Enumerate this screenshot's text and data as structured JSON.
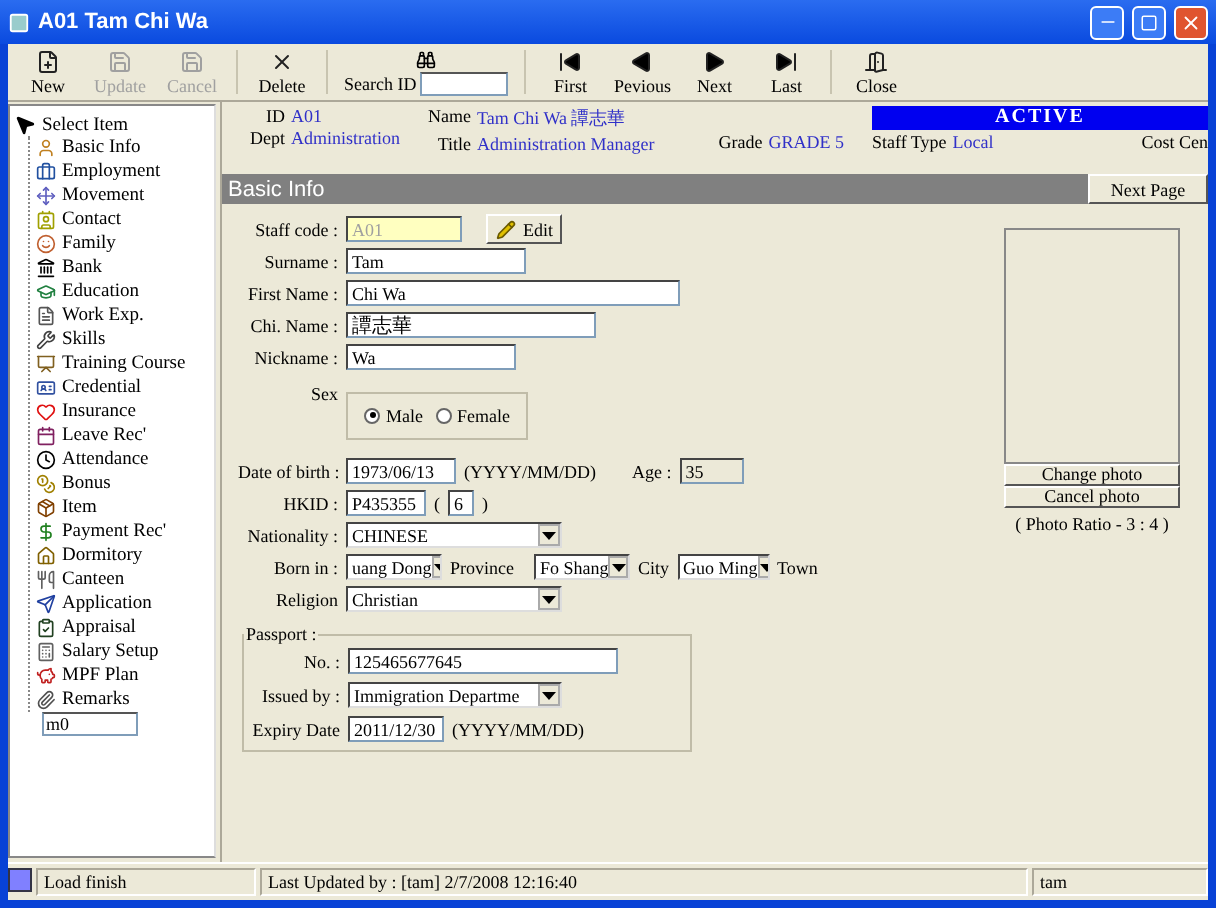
{
  "window": {
    "title": "A01 Tam Chi Wa"
  },
  "toolbar": [
    {
      "kind": "button",
      "label": "New",
      "disabled": false
    },
    {
      "kind": "button",
      "label": "Update",
      "disabled": true
    },
    {
      "kind": "button",
      "label": "Cancel",
      "disabled": true
    },
    {
      "kind": "button",
      "label": "Delete",
      "disabled": false
    },
    {
      "kind": "search",
      "label": "Search ID"
    },
    {
      "kind": "button",
      "label": "First",
      "disabled": false
    },
    {
      "kind": "button",
      "label": "Pevious",
      "disabled": false
    },
    {
      "kind": "button",
      "label": "Next",
      "disabled": false
    },
    {
      "kind": "button",
      "label": "Last",
      "disabled": false
    },
    {
      "kind": "button",
      "label": "Close",
      "disabled": false
    }
  ],
  "tree": {
    "label": "Select Item",
    "children": [
      {
        "label": "Basic Info"
      },
      {
        "label": "Employment"
      },
      {
        "label": "Movement"
      },
      {
        "label": "Contact"
      },
      {
        "label": "Family"
      },
      {
        "label": "Bank"
      },
      {
        "label": "Education"
      },
      {
        "label": "Work Exp."
      },
      {
        "label": "Skills"
      },
      {
        "label": "Training Course"
      },
      {
        "label": "Credential"
      },
      {
        "label": "Insurance"
      },
      {
        "label": "Leave Rec'"
      },
      {
        "label": "Attendance"
      },
      {
        "label": "Bonus"
      },
      {
        "label": "Item"
      },
      {
        "label": "Payment Rec'"
      },
      {
        "label": "Dormitory"
      },
      {
        "label": "Canteen"
      },
      {
        "label": "Application"
      },
      {
        "label": "Appraisal"
      },
      {
        "label": "Salary Setup"
      },
      {
        "label": "MPF Plan"
      },
      {
        "label": "Remarks"
      }
    ]
  },
  "sidebar_field": {
    "value": "m0"
  },
  "header": {
    "id_label": "ID",
    "id": "A01",
    "dept_label": "Dept",
    "dept": "Administration",
    "name_label": "Name",
    "name": "Tam Chi Wa  譚志華",
    "title_label": "Title",
    "title": "Administration Manager",
    "grade_label": "Grade",
    "grade": "GRADE 5",
    "status": "ACTIVE",
    "staff_type_label": "Staff Type",
    "staff_type": "Local",
    "cost_center_label": "Cost Cen"
  },
  "section": {
    "title": "Basic Info",
    "next_button": "Next Page"
  },
  "form": {
    "staff_code": {
      "label": "Staff code :",
      "value": "A01",
      "disabled": true
    },
    "edit_button": "Edit",
    "surname": {
      "label": "Surname :",
      "value": "Tam"
    },
    "first_name": {
      "label": "First Name :",
      "value": "Chi Wa"
    },
    "chi_name": {
      "label": "Chi. Name :",
      "value": "譚志華"
    },
    "nickname": {
      "label": "Nickname :",
      "value": "Wa"
    },
    "sex": {
      "label": "Sex",
      "options": [
        {
          "label": "Male",
          "selected": true
        },
        {
          "label": "Female",
          "selected": false
        }
      ]
    },
    "dob": {
      "label": "Date of birth :",
      "value": "1973/06/13",
      "hint": "(YYYY/MM/DD)"
    },
    "age": {
      "label": "Age :",
      "value": "35",
      "disabled": true
    },
    "hkid": {
      "label": "HKID :",
      "value": "P435355",
      "open": "(",
      "check": "6",
      "close": ")"
    },
    "nationality": {
      "label": "Nationality :",
      "value": "CHINESE"
    },
    "born_in": {
      "label": "Born in :",
      "province": "uang Dong",
      "province_label": "Province",
      "city": "Fo Shang",
      "city_label": "City",
      "town": "Guo Ming",
      "town_label": "Town"
    },
    "religion": {
      "label": "Religion",
      "value": "Christian"
    },
    "passport": {
      "title": "Passport :",
      "no_label": "No. :",
      "no": "125465677645",
      "issued_label": "Issued by :",
      "issued": "Immigration Departme",
      "expiry_label": "Expiry Date",
      "expiry": "2011/12/30",
      "expiry_hint": "(YYYY/MM/DD)"
    }
  },
  "photo": {
    "change_button": "Change photo",
    "cancel_button": "Cancel photo",
    "ratio": "( Photo Ratio - 3 : 4 )"
  },
  "status_bar": {
    "message": "Load finish",
    "updated": "Last Updated by : [tam]  2/7/2008 12:16:40",
    "user": "tam"
  }
}
